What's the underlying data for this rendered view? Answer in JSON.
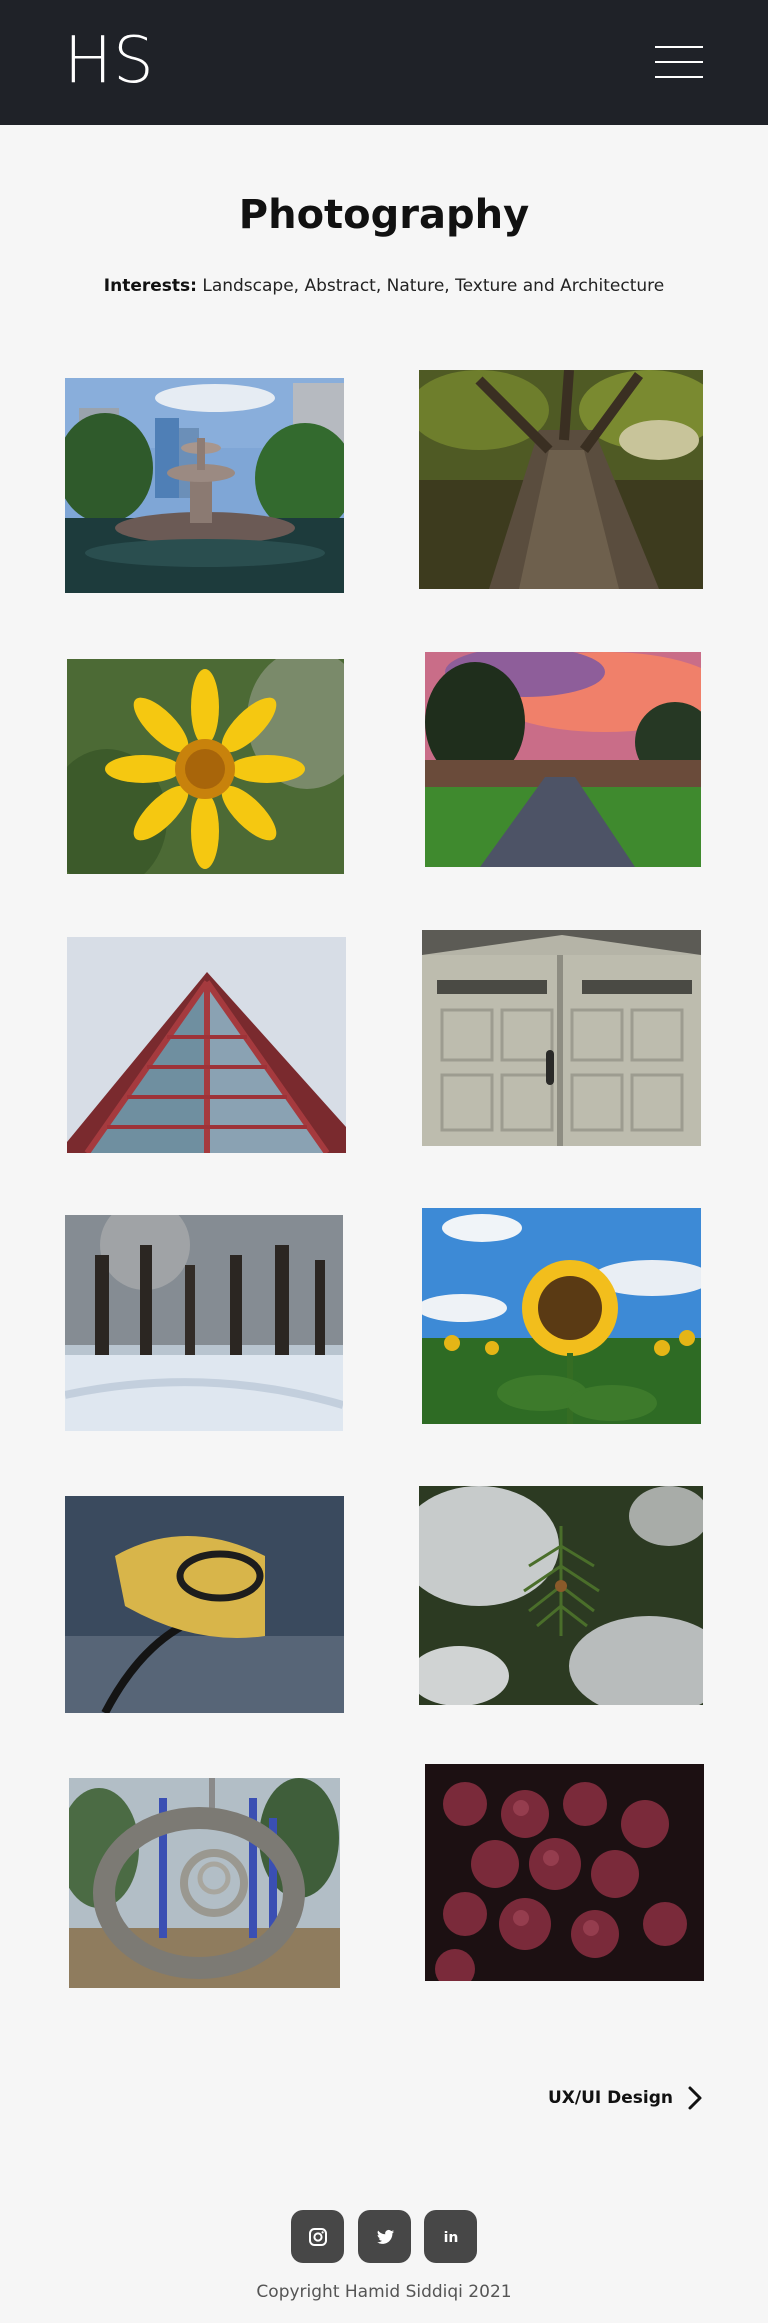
{
  "header": {
    "logo": "HS",
    "menu_icon": "hamburger-menu-icon"
  },
  "page": {
    "title": "Photography",
    "interests_label": "Interests:",
    "interests_text": " Landscape, Abstract, Nature, Texture and Architecture"
  },
  "gallery": {
    "photos": [
      "fountain-photo",
      "tree-trunk-photo",
      "yellow-daisy-photo",
      "sunset-path-photo",
      "glass-building-photo",
      "garage-door-photo",
      "snowy-forest-photo",
      "sunflower-field-photo",
      "basketball-hoop-photo",
      "pine-branch-photo",
      "playground-rings-photo",
      "grapes-photo"
    ]
  },
  "nav": {
    "next_label": "UX/UI Design",
    "next_icon": "chevron-right-icon"
  },
  "footer": {
    "social_icons": [
      "instagram-icon",
      "twitter-icon",
      "linkedin-icon"
    ],
    "linkedin_text": "in",
    "copyright": "Copyright Hamid Siddiqi  2021"
  }
}
